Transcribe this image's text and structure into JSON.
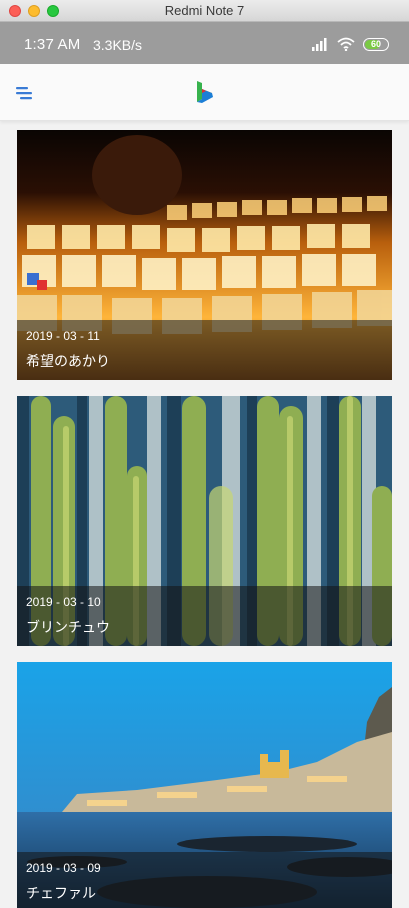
{
  "window": {
    "title": "Redmi Note 7"
  },
  "status_bar": {
    "time": "1:37  AM",
    "speed": "3.3KB/s",
    "battery": "60"
  },
  "feed": {
    "cards": [
      {
        "date": "2019 - 03 - 11",
        "title": "希望のあかり"
      },
      {
        "date": "2019 - 03 - 10",
        "title": "ブリンチュウ"
      },
      {
        "date": "2019 - 03 - 09",
        "title": "チェファル"
      }
    ]
  }
}
